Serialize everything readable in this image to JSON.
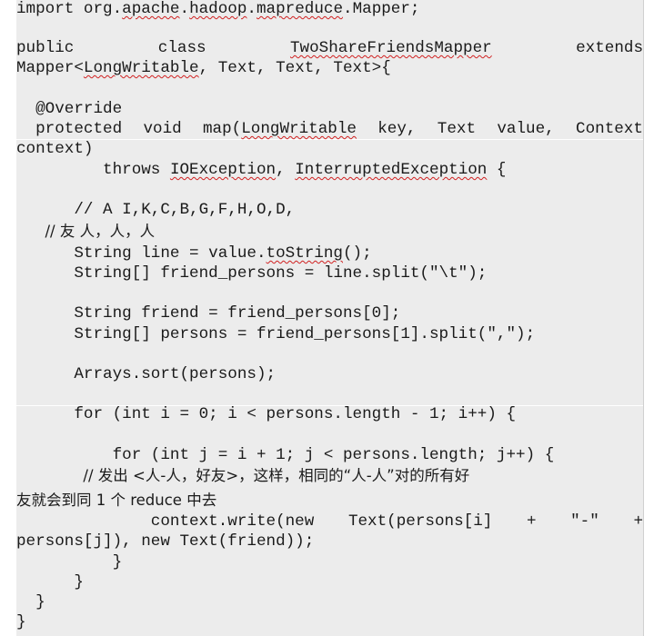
{
  "code": {
    "l01": {
      "a": "import org.",
      "b": "apache",
      "c": ".",
      "d": "hadoop",
      "e": ".",
      "f": "mapreduce",
      "g": ".Mapper;"
    },
    "l03": {
      "t1": "public",
      "t2": "class",
      "t3": "TwoShareFriendsMapper",
      "t4": "extends"
    },
    "l04": {
      "a": "Mapper<",
      "b": "LongWritable",
      "c": ", Text, Text, Text>{"
    },
    "l06": {
      "a": "  @Override"
    },
    "l07": {
      "t1": "  protected",
      "t2": "void",
      "t3": "map(",
      "t3b": "LongWritable",
      "t4": "key,",
      "t5": "Text",
      "t6": "value,",
      "t7": "Context"
    },
    "l08": {
      "a": "context)"
    },
    "l09": {
      "a": "         throws ",
      "b": "IOException",
      "c": ", ",
      "d": "InterruptedException",
      "e": " {"
    },
    "l11": {
      "a": "      // A I,K,C,B,G,F,H,O,D,"
    },
    "l12": {
      "a": "      // 友 人，人，人"
    },
    "l13": {
      "a": "      String line = value.",
      "b": "toString",
      "c": "();"
    },
    "l14": {
      "a": "      String[] friend_persons = line.split(\"\\t\");"
    },
    "l16": {
      "a": "      String friend = friend_persons[0];"
    },
    "l17": {
      "a": "      String[] persons = friend_persons[1].split(\",\");"
    },
    "l19": {
      "a": "      Arrays.sort(persons);"
    },
    "l21": {
      "a": "      for (int i = 0; i < persons.length - 1; i++) {"
    },
    "l23": {
      "a": "          for (int j = i + 1; j < persons.length; j++) {"
    },
    "l24": {
      "a": "              // 发出 <人-人，好友>，这样，相同的“人-人”对的所有好"
    },
    "l25": {
      "a": "友就会到同 1 个 reduce 中去"
    },
    "l26": {
      "t1": "              context.write(new",
      "t2": "Text(persons[i]",
      "t3": "+",
      "t4": "\"-\"",
      "t5": "+"
    },
    "l27": {
      "a": "persons[j]), new Text(friend));"
    },
    "l28": {
      "a": "          }"
    },
    "l29": {
      "a": "      }"
    },
    "l30": {
      "a": "  }"
    },
    "l31": {
      "a": "}"
    }
  }
}
